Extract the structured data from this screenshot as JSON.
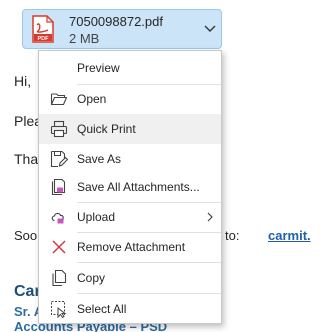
{
  "attachment": {
    "filename": "7050098872.pdf",
    "size": "2 MB",
    "icon": "pdf-icon",
    "icon_label": "PDF"
  },
  "email_body": {
    "greeting": "Hi,",
    "line2_fragment": "Plea",
    "line3_fragment": "Tha",
    "line4_fragment": "Soon",
    "line4_right": "to:",
    "link_fragment": "carmit.",
    "signature_name_fragment": "Car",
    "signature_title_fragment": "Sr. A",
    "signature_dept": "Accounts Payable – PSD"
  },
  "context_menu": {
    "items": [
      {
        "label": "Preview",
        "icon": "none"
      },
      {
        "label": "Open",
        "icon": "folder-open-icon"
      },
      {
        "label": "Quick Print",
        "icon": "printer-icon",
        "hovered": true
      },
      {
        "label": "Save As",
        "icon": "save-as-icon"
      },
      {
        "label": "Save All Attachments...",
        "icon": "save-all-icon"
      },
      {
        "label": "Upload",
        "icon": "upload-cloud-icon",
        "has_submenu": true
      },
      {
        "label": "Remove Attachment",
        "icon": "remove-x-icon"
      },
      {
        "label": "Copy",
        "icon": "copy-icon"
      },
      {
        "label": "Select All",
        "icon": "select-all-icon"
      }
    ]
  },
  "colors": {
    "chip_background": "#cce4f7",
    "pdf_red": "#d93a2b",
    "remove_red": "#d13438",
    "link_blue": "#1f5fa8",
    "signature_blue": "#1f4e79"
  }
}
